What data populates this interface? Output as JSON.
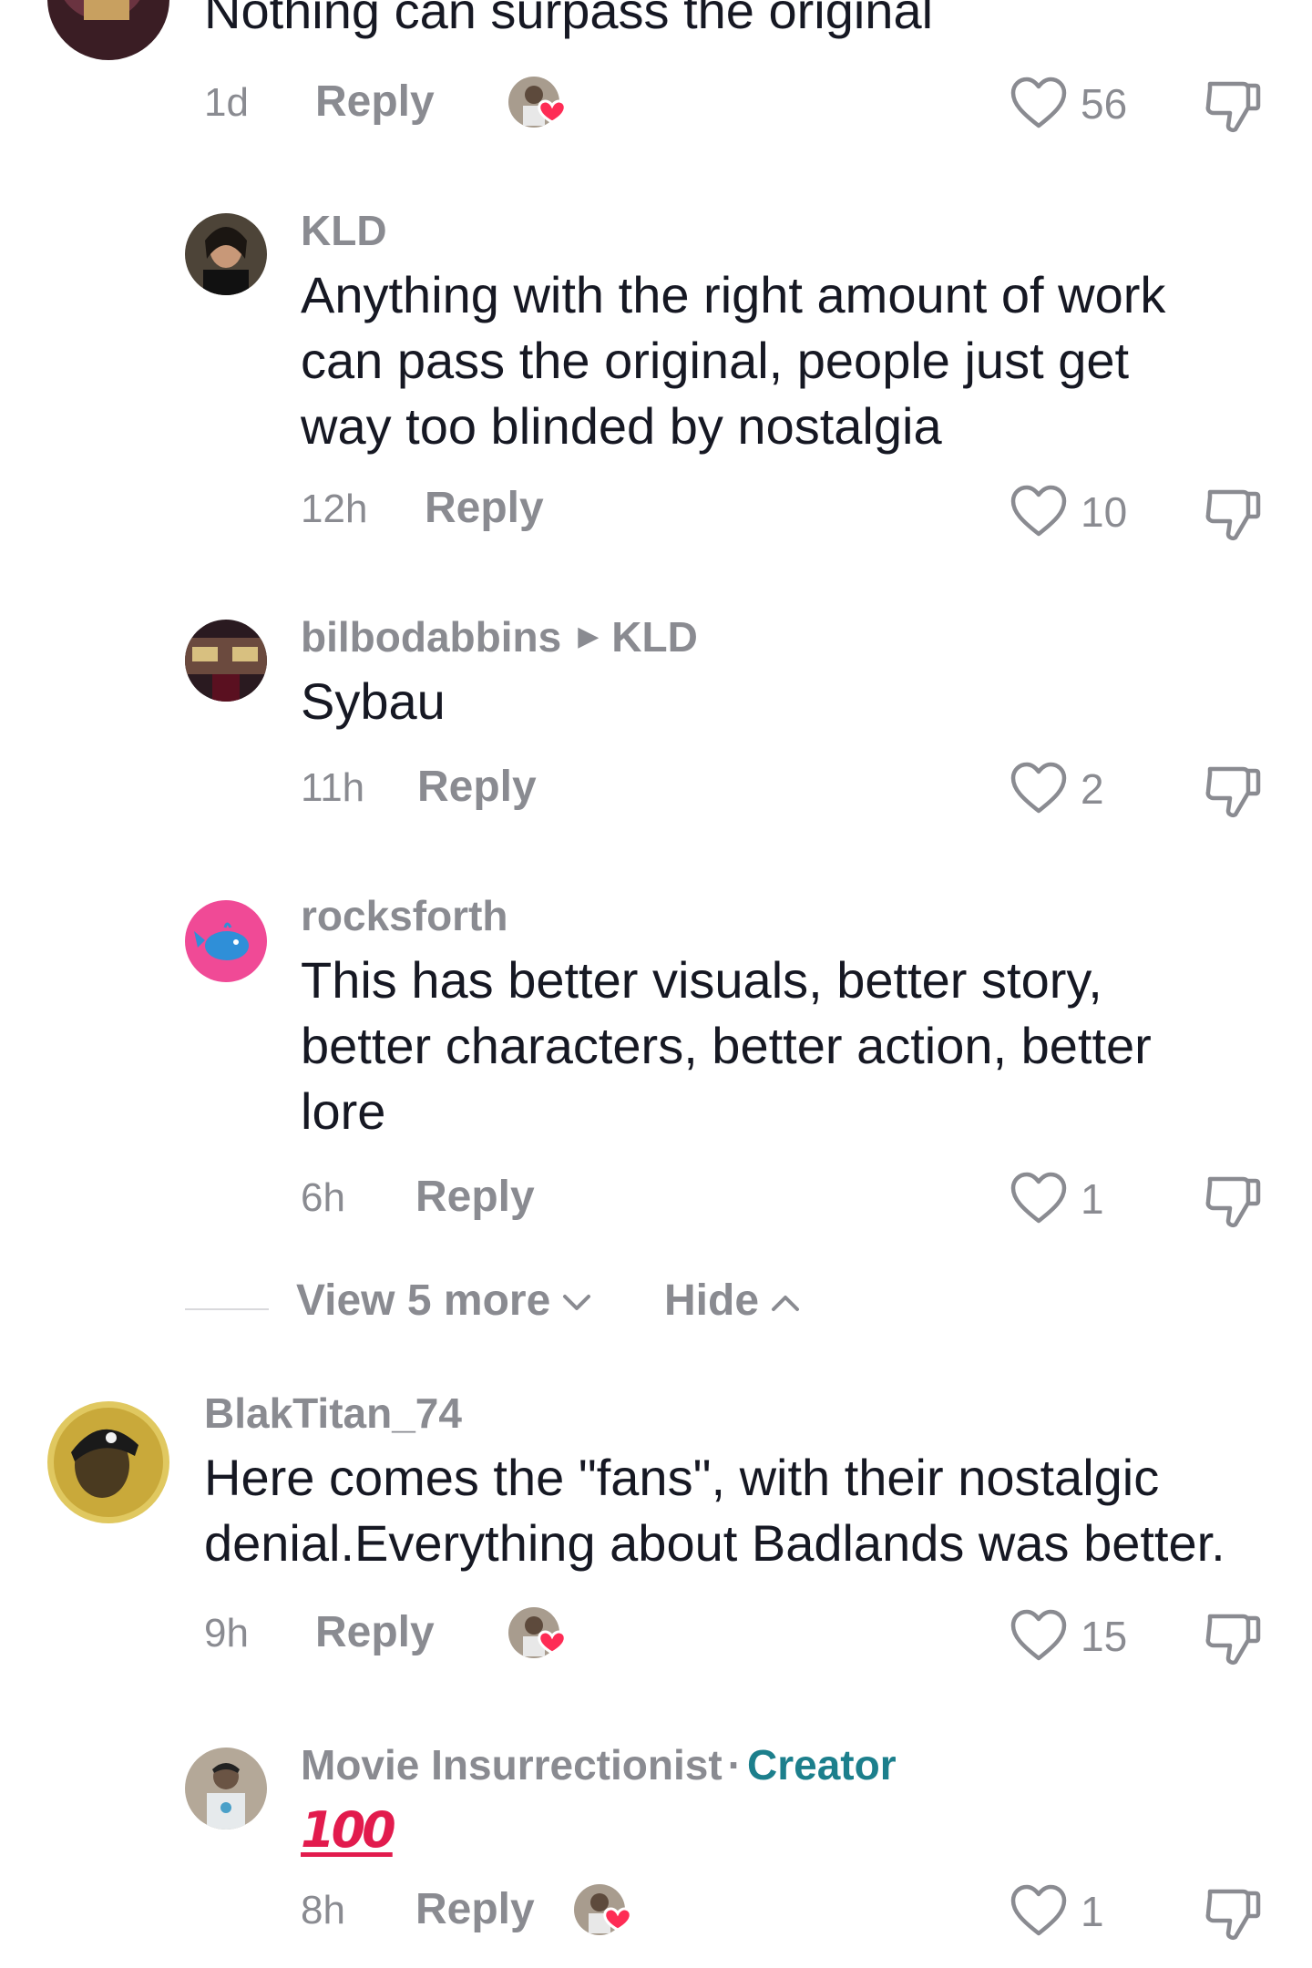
{
  "comments": [
    {
      "text": "Nothing can surpass the original",
      "time": "1d",
      "reply_label": "Reply",
      "likes": "56",
      "creator_liked": true
    },
    {
      "username": "KLD",
      "text_lines": [
        "Anything with the right amount of work",
        "can pass the original, people just get",
        "way too blinded by nostalgia"
      ],
      "time": "12h",
      "reply_label": "Reply",
      "likes": "10"
    },
    {
      "username": "bilbodabbins",
      "reply_to": "KLD",
      "text": "Sybau",
      "time": "11h",
      "reply_label": "Reply",
      "likes": "2"
    },
    {
      "username": "rocksforth",
      "text_lines": [
        "This has better visuals, better story,",
        "better characters, better action, better",
        "lore"
      ],
      "time": "6h",
      "reply_label": "Reply",
      "likes": "1"
    },
    {
      "username": "BlakTitan_74",
      "text_lines": [
        "Here comes the \"fans\", with their nostalgic",
        "denial.Everything about Badlands was better."
      ],
      "time": "9h",
      "reply_label": "Reply",
      "likes": "15",
      "creator_liked": true
    },
    {
      "username": "Movie Insurrectionist",
      "creator_separator": "·",
      "creator_label": "Creator",
      "text": "100",
      "time": "8h",
      "reply_label": "Reply",
      "likes": "1",
      "creator_liked": true
    }
  ],
  "replies_control": {
    "view_more_label": "View 5 more",
    "hide_label": "Hide"
  },
  "colors": {
    "text": "#161823",
    "muted": "#8a8b91",
    "creator": "#1c7f8c",
    "heart_red": "#fe2c55"
  },
  "icons": {
    "like": "heart-outline-icon",
    "dislike": "thumbs-down-icon",
    "creator_like": "creator-heart-badge-icon",
    "chevron_down": "chevron-down-icon",
    "chevron_up": "chevron-up-icon"
  }
}
